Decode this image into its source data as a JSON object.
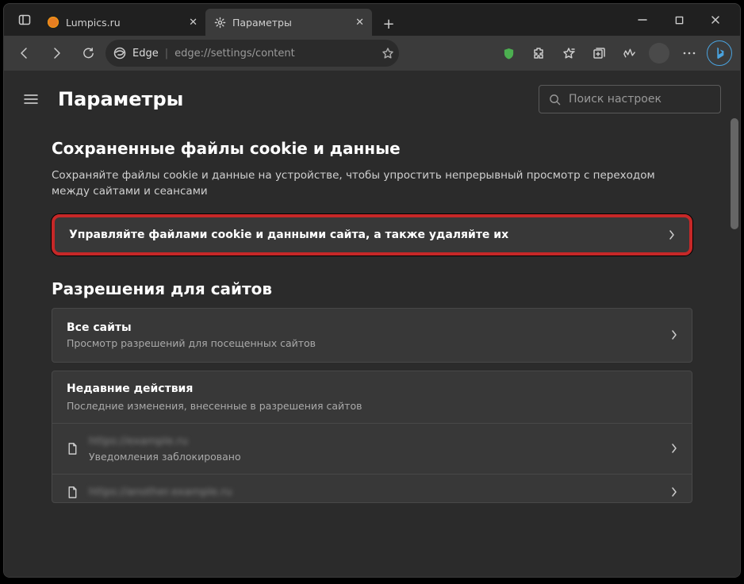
{
  "tabs": [
    {
      "title": "Lumpics.ru",
      "favicon": "orange",
      "active": false
    },
    {
      "title": "Параметры",
      "favicon": "gear",
      "active": true
    }
  ],
  "address_bar": {
    "label": "Edge",
    "url": "edge://settings/content"
  },
  "header": {
    "title": "Параметры",
    "search_placeholder": "Поиск настроек"
  },
  "cookies_section": {
    "heading": "Сохраненные файлы cookie и данные",
    "description": "Сохраняйте файлы cookie и данные на устройстве, чтобы упростить непрерывный просмотр с переходом между сайтами и сеансами",
    "manage_link": "Управляйте файлами cookie и данными сайта, а также удаляйте их"
  },
  "permissions_section": {
    "heading": "Разрешения для сайтов",
    "all_sites_title": "Все сайты",
    "all_sites_sub": "Просмотр разрешений для посещенных сайтов",
    "recent_title": "Недавние действия",
    "recent_sub": "Последние изменения, внесенные в разрешения сайтов",
    "recent_items": [
      {
        "url": "https://example.ru",
        "status": "Уведомления заблокировано"
      },
      {
        "url": "https://another.example.ru",
        "status": ""
      }
    ]
  }
}
